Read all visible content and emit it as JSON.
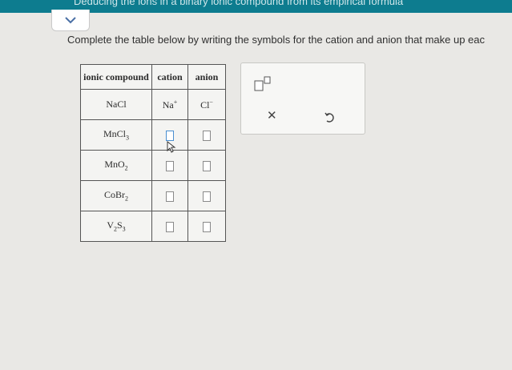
{
  "header": {
    "title": "Deducing the ions in a binary ionic compound from its empirical formula"
  },
  "instructions": "Complete the table below by writing the symbols for the cation and anion that make up eac",
  "table": {
    "headers": {
      "compound": "ionic compound",
      "cation": "cation",
      "anion": "anion"
    },
    "rows": [
      {
        "compound": "NaCl",
        "cation": "Na",
        "cation_charge": "+",
        "anion": "Cl",
        "anion_charge": "−"
      },
      {
        "compound": "MnCl",
        "subscript": "3"
      },
      {
        "compound": "MnO",
        "subscript": "2"
      },
      {
        "compound": "CoBr",
        "subscript": "2"
      },
      {
        "compound_a": "V",
        "sub_a": "2",
        "compound_b": "S",
        "sub_b": "3"
      }
    ]
  },
  "panel": {
    "superscript_tool_icon": "superscript-icon",
    "clear_icon": "close-icon",
    "undo_icon": "undo-icon"
  },
  "colors": {
    "header_bar": "#0d7c8f",
    "active_box": "#4a8fd1"
  }
}
